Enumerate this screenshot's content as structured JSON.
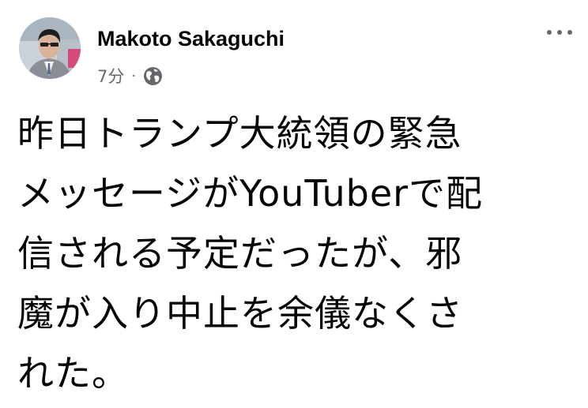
{
  "post": {
    "author_name": "Makoto Sakaguchi",
    "timestamp": "7分",
    "separator": "·",
    "privacy_icon": "globe-icon",
    "more_icon": "more-options-icon",
    "text_lines": [
      "昨日トランプ大統領の緊急",
      "メッセージがYouTuberで配",
      "信される予定だったが、邪",
      "魔が入り中止を余儀なくさ",
      "れた。"
    ]
  },
  "colors": {
    "primary_text": "#050505",
    "secondary_text": "#65676b",
    "background": "#ffffff"
  }
}
